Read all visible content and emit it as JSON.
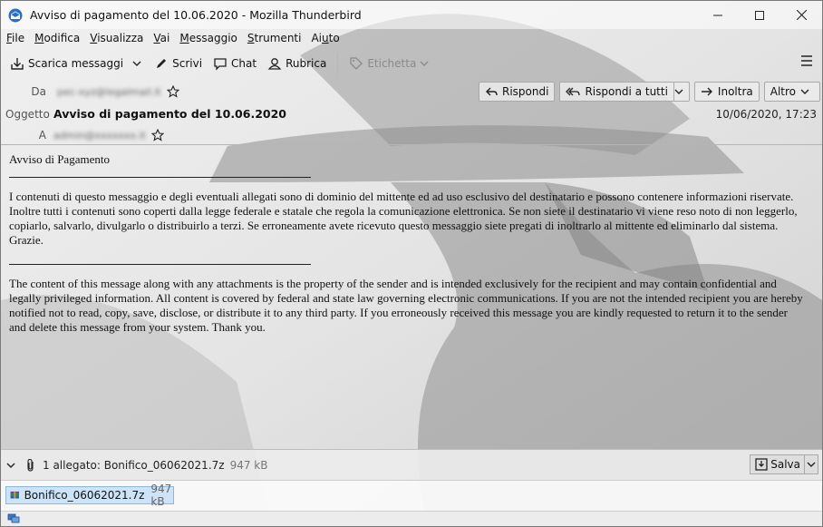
{
  "window": {
    "title": "Avviso di pagamento del 10.06.2020 - Mozilla Thunderbird",
    "minimize_icon": "minimize-icon",
    "maximize_icon": "maximize-icon",
    "close_icon": "close-icon"
  },
  "menubar": [
    {
      "pre": "",
      "u": "F",
      "post": "ile"
    },
    {
      "pre": "",
      "u": "M",
      "post": "odifica"
    },
    {
      "pre": "",
      "u": "V",
      "post": "isualizza"
    },
    {
      "pre": "",
      "u": "V",
      "post": "ai"
    },
    {
      "pre": "",
      "u": "M",
      "post": "essaggio"
    },
    {
      "pre": "",
      "u": "S",
      "post": "trumenti"
    },
    {
      "pre": "Ai",
      "u": "u",
      "post": "to"
    }
  ],
  "toolbar": {
    "get_messages": "Scarica messaggi",
    "write": "Scrivi",
    "chat": "Chat",
    "address_book": "Rubrica",
    "tag": "Etichetta"
  },
  "header": {
    "from_label": "Da",
    "from_value": "pec-xyz@legalmail.it",
    "subject_label": "Oggetto",
    "subject_value": "Avviso di pagamento del 10.06.2020",
    "to_label": "A",
    "to_value": "admin@xxxxxxx.it",
    "date": "10/06/2020, 17:23",
    "actions": {
      "reply": "Rispondi",
      "reply_all": "Rispondi a tutti",
      "forward": "Inoltra",
      "other": "Altro"
    }
  },
  "body": {
    "greeting": "Avviso di Pagamento",
    "italian_notice": "I contenuti di questo messaggio e degli eventuali allegati sono di dominio del mittente ed ad uso esclusivo del destinatario e possono contenere informazioni riservate. Inoltre tutti i contenuti sono coperti dalla legge federale e statale che regola la comunicazione elettronica. Se non siete il destinatario vi viene reso noto di non leggerlo, copiarlo, salvarlo, divulgarlo o distribuirlo a terzi. Se erroneamente avete ricevuto questo messaggio siete pregati di inoltrarlo al mittente ed eliminarlo dal sistema. Grazie.",
    "english_notice": "The content of this message along with any attachments is the property of the sender and is intended exclusively for the recipient and may contain confidential and legally privileged information. All content is covered by federal and state law governing electronic communications. If you are not the intended recipient you are hereby notified not to read, copy, save, disclose, or distribute it to any third party. If you erroneously received this message you are kindly requested to return it to the sender and delete this message from your system. Thank you."
  },
  "attachments": {
    "summary": "1 allegato: Bonifico_06062021.7z",
    "summary_size": "947 kB",
    "save_label": "Salva",
    "items": [
      {
        "name": "Bonifico_06062021.7z",
        "size": "947 kB"
      }
    ]
  },
  "colors": {
    "selection_bg": "#cde3f7",
    "selection_border": "#8fb7dc",
    "accent": "#2a6fc0"
  }
}
